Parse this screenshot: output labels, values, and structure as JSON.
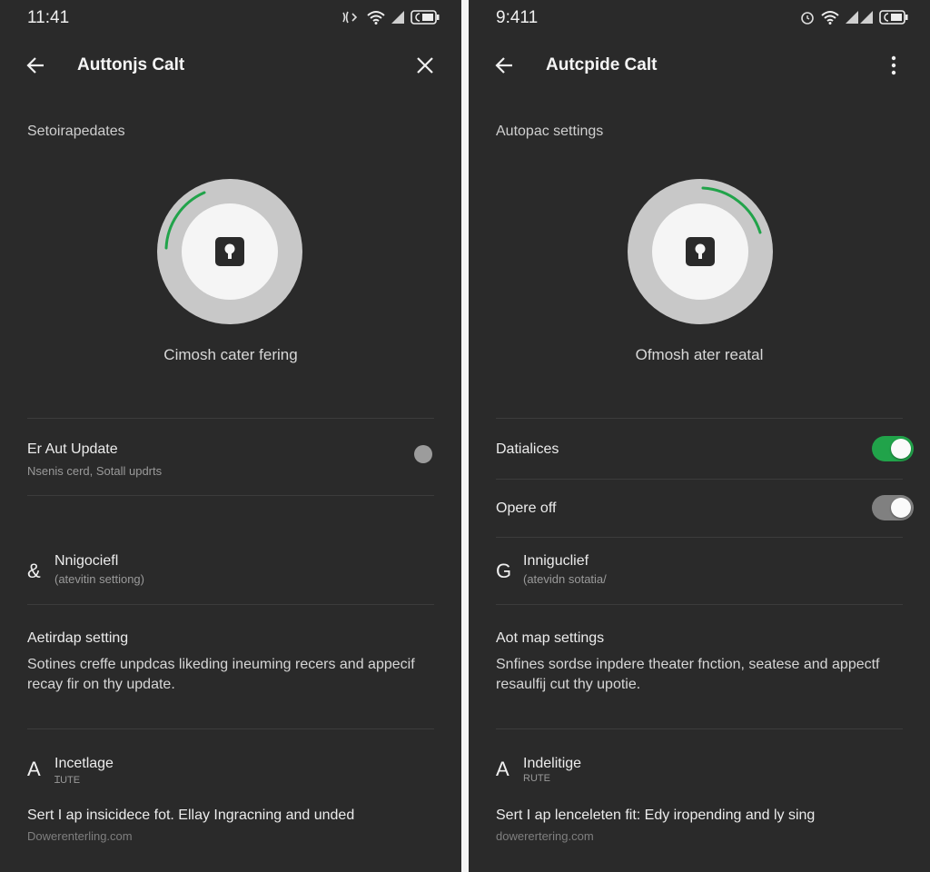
{
  "left": {
    "status": {
      "time": "11:41"
    },
    "app_bar": {
      "title": "Auttonjs Calt"
    },
    "section_title": "Setoirapedates",
    "dial_caption": "Cimosh cater fering",
    "row_update": {
      "title": "Er Aut Update",
      "subtitle": "Nsenis cerd, Sotall updrts"
    },
    "row_nav": {
      "icon": "&",
      "title": "Nnigociefl",
      "subtitle": "(atevitin settiong)"
    },
    "map_section": {
      "title": "Aetirdap setting",
      "body": "Sotines creffe unpdcas likeding ineuming recers and appecif recay fir on thy update."
    },
    "row_intel": {
      "icon": "A",
      "title": "Incetlage",
      "subtitle": "ꞮUTE",
      "body": "Sert I ap insicidece fot. Ellay Ingracning and unded",
      "hint": "Dowerenterling.com"
    }
  },
  "right": {
    "status": {
      "time": "9:411"
    },
    "app_bar": {
      "title": "Autcpide Calt"
    },
    "section_title": "Autopac settings",
    "dial_caption": "Ofmosh ater reatal",
    "row_toggle1": {
      "label": "Datialices",
      "on": true
    },
    "row_toggle2": {
      "label": "Opere off",
      "on": false
    },
    "row_nav": {
      "icon": "G",
      "title": "Inniguclief",
      "subtitle": "(atevidn sotatia/"
    },
    "map_section": {
      "title": "Aot map settings",
      "body": "Snfines sordse inpdere theater fnction, seatese and appectf resaulfij cut thy upotie."
    },
    "row_intel": {
      "icon": "A",
      "title": "Indelitige",
      "subtitle": "RUTE",
      "body": "Sert I ap lenceleten fit: Edy iropending and ly sing",
      "hint": "dowerertering.com"
    }
  },
  "colors": {
    "background": "#2a2a2a",
    "accent_green": "#21a34a",
    "dial_ring": "#c8c8c8",
    "dial_center": "#f5f5f5"
  },
  "icons": {
    "back": "arrow-left-icon",
    "close": "close-icon",
    "menu": "more-vert-icon",
    "lock": "lock-icon",
    "wifi": "wifi-icon",
    "signal": "signal-icon",
    "battery": "battery-icon"
  }
}
